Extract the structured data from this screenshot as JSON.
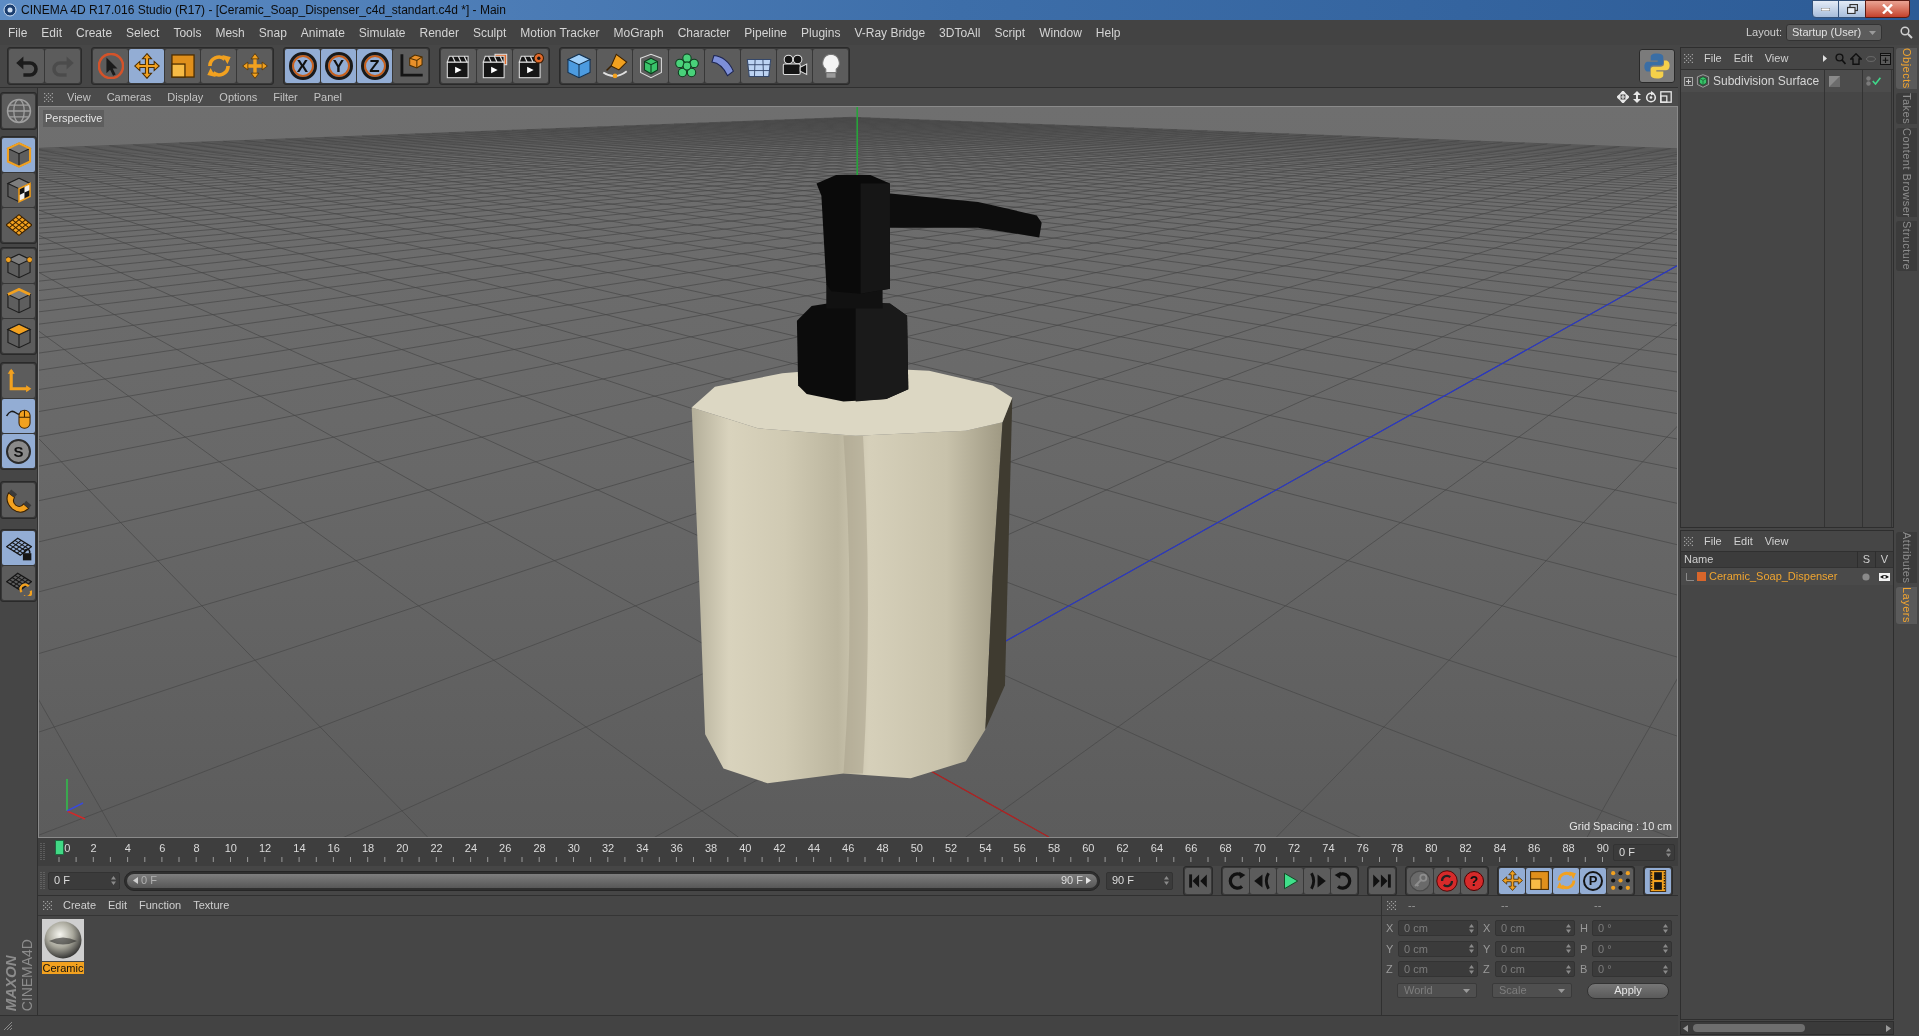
{
  "window": {
    "title": "CINEMA 4D R17.016 Studio (R17) - [Ceramic_Soap_Dispenser_c4d_standart.c4d *] - Main"
  },
  "menu_bar": {
    "items": [
      "File",
      "Edit",
      "Create",
      "Select",
      "Tools",
      "Mesh",
      "Snap",
      "Animate",
      "Simulate",
      "Render",
      "Sculpt",
      "Motion Tracker",
      "MoGraph",
      "Character",
      "Pipeline",
      "Plugins",
      "V-Ray Bridge",
      "3DToAll",
      "Script",
      "Window",
      "Help"
    ],
    "layout_label": "Layout:",
    "layout_value": "Startup (User)"
  },
  "toolbar": {
    "history": [
      {
        "kind": "undo",
        "disabled": false
      },
      {
        "kind": "redo",
        "disabled": true
      }
    ],
    "tools": [
      {
        "kind": "select",
        "selected": false
      },
      {
        "kind": "move",
        "selected": true
      },
      {
        "kind": "scale",
        "selected": false
      },
      {
        "kind": "rotate",
        "selected": false
      },
      {
        "kind": "transform",
        "selected": false
      }
    ],
    "axes": [
      {
        "label": "X",
        "selected": true
      },
      {
        "label": "Y",
        "selected": true
      },
      {
        "label": "Z",
        "selected": true
      }
    ],
    "render": [
      {
        "kind": "render_view"
      },
      {
        "kind": "render_picture"
      },
      {
        "kind": "render_settings"
      }
    ],
    "objects": [
      {
        "kind": "cube"
      },
      {
        "kind": "pen"
      },
      {
        "kind": "subdivision"
      },
      {
        "kind": "cloner"
      },
      {
        "kind": "deformer"
      },
      {
        "kind": "floor"
      },
      {
        "kind": "camera"
      },
      {
        "kind": "light"
      }
    ]
  },
  "left_toolbar": {
    "groups": [
      [
        {
          "kind": "globe",
          "selected": false
        }
      ],
      [
        {
          "kind": "model",
          "selected": true
        },
        {
          "kind": "texture",
          "selected": false
        },
        {
          "kind": "workplane",
          "selected": false
        }
      ],
      [
        {
          "kind": "points",
          "selected": false
        },
        {
          "kind": "edges",
          "selected": false
        },
        {
          "kind": "polygons",
          "selected": false
        }
      ],
      [
        {
          "kind": "axis",
          "selected": false
        },
        {
          "kind": "tweak",
          "selected": true
        },
        {
          "kind": "solo",
          "label": "S",
          "selected": true
        }
      ],
      [
        {
          "kind": "magnet",
          "selected": false
        }
      ],
      [
        {
          "kind": "grid_lock",
          "selected": true
        },
        {
          "kind": "grid_refresh",
          "selected": false
        }
      ]
    ]
  },
  "viewport": {
    "menu": [
      "View",
      "Cameras",
      "Display",
      "Options",
      "Filter",
      "Panel"
    ],
    "camera": "Perspective",
    "grid_spacing": "Grid Spacing : 10 cm"
  },
  "timeline": {
    "ticks": [
      "0",
      "2",
      "4",
      "6",
      "8",
      "10",
      "12",
      "14",
      "16",
      "18",
      "20",
      "22",
      "24",
      "26",
      "28",
      "30",
      "32",
      "34",
      "36",
      "38",
      "40",
      "42",
      "44",
      "46",
      "48",
      "50",
      "52",
      "54",
      "56",
      "58",
      "60",
      "62",
      "64",
      "66",
      "68",
      "70",
      "72",
      "74",
      "76",
      "78",
      "80",
      "82",
      "84",
      "86",
      "88",
      "90"
    ],
    "playhead": {
      "level": 0
    },
    "frame_field": "0 F"
  },
  "frame_controls": {
    "start": "0 F",
    "range": {
      "start": "0 F",
      "end": "90 F",
      "level": 1
    },
    "end": "90 F",
    "transport": [
      [
        {
          "kind": "first"
        }
      ],
      [
        {
          "kind": "loop_back"
        },
        {
          "kind": "step_back"
        },
        {
          "kind": "play"
        },
        {
          "kind": "step_forward"
        },
        {
          "kind": "loop_forward"
        }
      ],
      [
        {
          "kind": "last"
        }
      ]
    ],
    "record": [
      {
        "kind": "keyframe"
      },
      {
        "kind": "autokey"
      },
      {
        "kind": "help",
        "label": "?"
      }
    ],
    "keys": [
      {
        "kind": "move",
        "selected": true
      },
      {
        "kind": "scale",
        "selected": true
      },
      {
        "kind": "rotate",
        "selected": true
      },
      {
        "kind": "param",
        "label": "P",
        "selected": true
      },
      {
        "kind": "points",
        "selected": false
      }
    ],
    "layout_buttons": [
      {
        "kind": "film",
        "selected": true
      }
    ]
  },
  "materials": {
    "menu": [
      "Create",
      "Edit",
      "Function",
      "Texture"
    ],
    "items": [
      {
        "name": "Ceramic",
        "selected": true
      }
    ]
  },
  "coordinates": {
    "headers": [
      "--",
      "--",
      "--"
    ],
    "rows": [
      {
        "axis": "X",
        "position": "0 cm",
        "size_axis": "X",
        "size": "0 cm",
        "rotation_axis": "H",
        "rotation": "0 °"
      },
      {
        "axis": "Y",
        "position": "0 cm",
        "size_axis": "Y",
        "size": "0 cm",
        "rotation_axis": "P",
        "rotation": "0 °"
      },
      {
        "axis": "Z",
        "position": "0 cm",
        "size_axis": "Z",
        "size": "0 cm",
        "rotation_axis": "B",
        "rotation": "0 °"
      }
    ],
    "mode": "World",
    "size_mode": "Scale",
    "apply": "Apply"
  },
  "object_manager": {
    "menu": [
      "File",
      "Edit",
      "View"
    ],
    "objects": [
      {
        "name": "Subdivision Surface",
        "enabled": true
      }
    ]
  },
  "layer_manager": {
    "menu": [
      "File",
      "Edit",
      "View"
    ],
    "columns": [
      "Name",
      "S",
      "V"
    ],
    "layers": [
      {
        "name": "Ceramic_Soap_Dispenser",
        "color": "#d9662b"
      }
    ]
  },
  "side_tabs": {
    "top": [
      {
        "label": "Objects",
        "selected": true
      },
      {
        "label": "Takes",
        "selected": false
      },
      {
        "label": "Content Browser",
        "selected": false
      },
      {
        "label": "Structure",
        "selected": false
      }
    ],
    "bottom": [
      {
        "label": "Attributes",
        "selected": false
      },
      {
        "label": "Layers",
        "selected": true
      }
    ]
  },
  "branding": {
    "maker": "MAXON",
    "product": "CINEMA4D"
  }
}
